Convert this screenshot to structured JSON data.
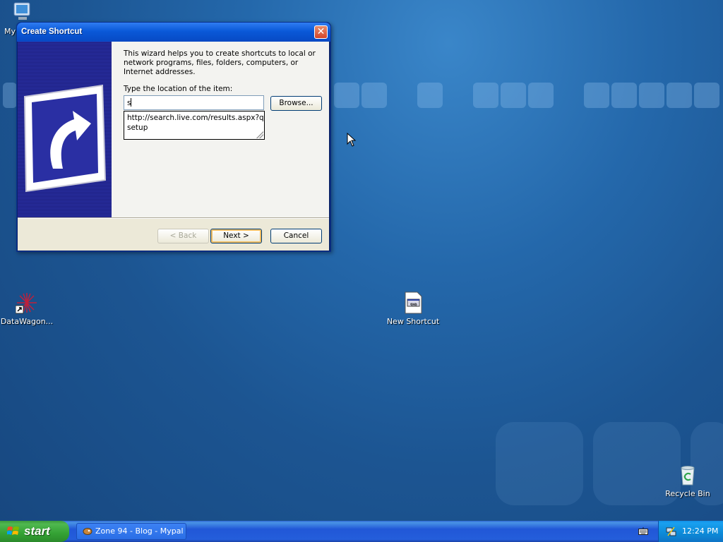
{
  "desktop": {
    "icons": [
      {
        "label": "My"
      },
      {
        "label": "DataWagon..."
      },
      {
        "label": "New Shortcut"
      },
      {
        "label": "Recycle Bin"
      }
    ]
  },
  "dialog": {
    "title": "Create Shortcut",
    "close_symbol": "✕",
    "intro_text": "This wizard helps you to create shortcuts to local or network programs, files, folders, computers, or Internet addresses.",
    "location_label": "Type the location of the item:",
    "location_value": "s",
    "autocomplete": [
      "http://search.live.com/results.aspx?q=p",
      "setup"
    ],
    "browse_label": "Browse...",
    "back_label": "< Back",
    "next_label": "Next >",
    "cancel_label": "Cancel"
  },
  "taskbar": {
    "start_label": "start",
    "task_label": "Zone 94 - Blog - Mypal",
    "clock": "12:24 PM"
  },
  "colors": {
    "titlebar": "#0a59d8",
    "banner": "#2a2fa3",
    "taskbar": "#245edb",
    "start": "#34a234"
  }
}
